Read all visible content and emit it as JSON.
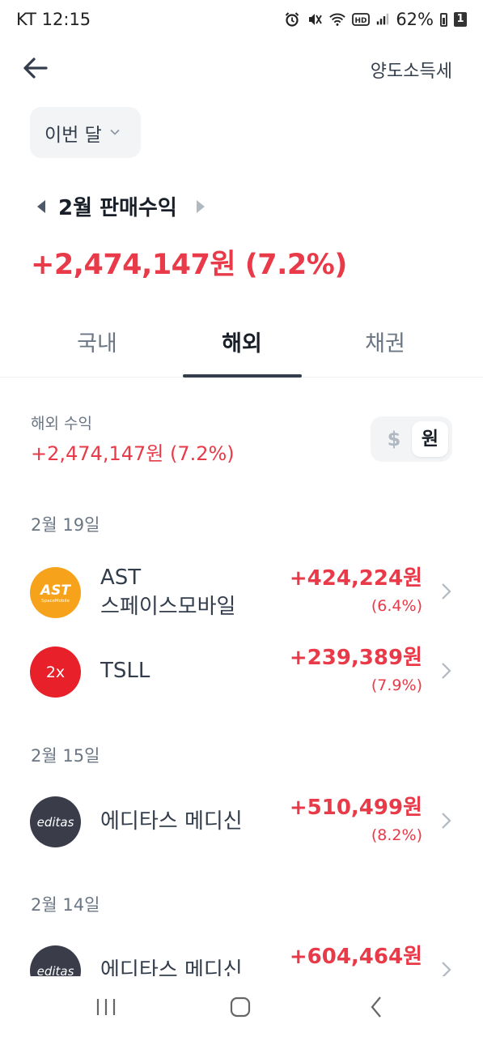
{
  "status_bar": {
    "carrier_time": "KT 12:15",
    "battery_percent": "62%",
    "sim_badge": "1",
    "icons": [
      "alarm-icon",
      "mute-icon",
      "wifi-icon",
      "hd-icon",
      "signal-icon",
      "battery-icon"
    ]
  },
  "header": {
    "back_icon": "arrow-left-icon",
    "right_label": "양도소득세"
  },
  "period": {
    "label": "이번 달",
    "icon": "chevron-down-icon"
  },
  "month_nav": {
    "title": "2월 판매수익",
    "prev_icon": "triangle-left-icon",
    "next_icon": "triangle-right-icon"
  },
  "total_profit": "+2,474,147원 (7.2%)",
  "tabs": [
    {
      "label": "국내",
      "active": false
    },
    {
      "label": "해외",
      "active": true
    },
    {
      "label": "채권",
      "active": false
    }
  ],
  "summary": {
    "label": "해외 수익",
    "value": "+2,474,147원 (7.2%)"
  },
  "currency_toggle": {
    "dollar": "$",
    "won": "원",
    "selected": "원"
  },
  "groups": [
    {
      "date": "2월 19일",
      "items": [
        {
          "name_line1": "AST",
          "name_line2": "스페이스모바일",
          "amount": "+424,224원",
          "pct": "(6.4%)",
          "logo_text": "AST",
          "logo_subtext": "SpaceMobile",
          "logo_color": "#f7a21b"
        },
        {
          "name_line1": "TSLL",
          "name_line2": "",
          "amount": "+239,389원",
          "pct": "(7.9%)",
          "logo_text": "2x",
          "logo_color": "#e8202a"
        }
      ]
    },
    {
      "date": "2월 15일",
      "items": [
        {
          "name_line1": "에디타스 메디신",
          "name_line2": "",
          "amount": "+510,499원",
          "pct": "(8.2%)",
          "logo_text": "editas",
          "logo_color": "#3a3d49"
        }
      ]
    },
    {
      "date": "2월 14일",
      "items": [
        {
          "name_line1": "에디타스 메디신",
          "name_line2": "",
          "amount": "+604,464원",
          "pct": "",
          "logo_text": "editas",
          "logo_color": "#3a3d49"
        }
      ]
    }
  ],
  "colors": {
    "profit_red": "#e83a48",
    "text_dark": "#191f28",
    "text_gray": "#6b7684",
    "chip_bg": "#f2f4f6"
  },
  "nav_bar": {
    "icons": [
      "recent-apps-icon",
      "home-icon",
      "back-icon"
    ]
  }
}
